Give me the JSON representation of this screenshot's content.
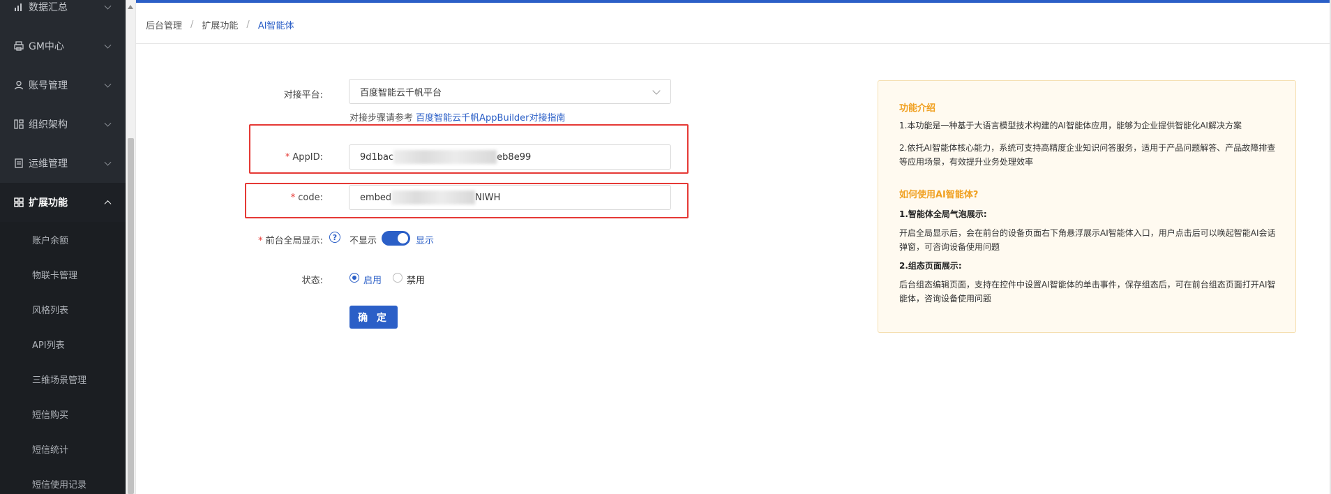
{
  "sidebar": {
    "items": [
      {
        "label": "数据汇总",
        "icon": "bar-chart-icon"
      },
      {
        "label": "GM中心",
        "icon": "printer-icon"
      },
      {
        "label": "账号管理",
        "icon": "user-icon"
      },
      {
        "label": "组织架构",
        "icon": "org-icon"
      },
      {
        "label": "运维管理",
        "icon": "document-icon"
      },
      {
        "label": "扩展功能",
        "icon": "grid-icon"
      }
    ],
    "sub_items": [
      "账户余额",
      "物联卡管理",
      "风格列表",
      "API列表",
      "三维场景管理",
      "短信购买",
      "短信统计",
      "短信使用记录"
    ]
  },
  "breadcrumb": {
    "items": [
      "后台管理",
      "扩展功能",
      "AI智能体"
    ]
  },
  "form": {
    "platform_label": "对接平台:",
    "platform_value": "百度智能云千帆平台",
    "hint_text": "对接步骤请参考",
    "hint_link": "百度智能云千帆AppBuilder对接指南",
    "appid_label": "AppID:",
    "appid_prefix": "9d1bac",
    "appid_suffix": "eb8e99",
    "code_label": "code:",
    "code_prefix": "embed",
    "code_suffix": "NIWH",
    "display_label": "前台全局显示:",
    "display_off": "不显示",
    "display_on": "显示",
    "display_enabled": true,
    "status_label": "状态:",
    "status_enabled": "启用",
    "status_disabled": "禁用",
    "submit": "确 定"
  },
  "info": {
    "title": "功能介绍",
    "p1": "1.本功能是一种基于大语言模型技术构建的AI智能体应用，能够为企业提供智能化AI解决方案",
    "p2": "2.依托AI智能体核心能力，系统可支持高精度企业知识问答服务，适用于产品问题解答、产品故障排查等应用场景，有效提升业务处理效率",
    "how_title": "如何使用AI智能体?",
    "s1_title": "1.智能体全局气泡展示:",
    "s1_text": "开启全局显示后，会在前台的设备页面右下角悬浮展示AI智能体入口，用户点击后可以唤起智能AI会话弹窗，可咨询设备使用问题",
    "s2_title": "2.组态页面展示:",
    "s2_text": "后台组态编辑页面，支持在控件中设置AI智能体的单击事件，保存组态后，可在前台组态页面打开AI智能体，咨询设备使用问题"
  }
}
